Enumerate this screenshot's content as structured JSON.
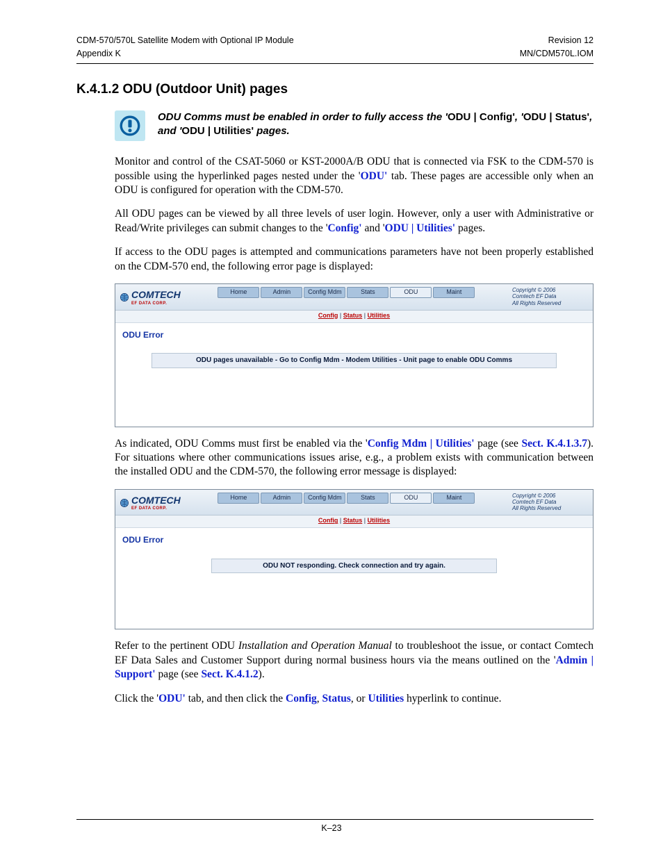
{
  "header": {
    "left1": "CDM-570/570L Satellite Modem with Optional IP Module",
    "left2": "Appendix K",
    "right1": "Revision 12",
    "right2": "MN/CDM570L.IOM"
  },
  "footer": {
    "page_num": "K–23"
  },
  "section": {
    "heading": "K.4.1.2   ODU (Outdoor Unit) pages"
  },
  "notice": {
    "lead": "ODU Comms must be enabled in order to fully access the '",
    "b1": "ODU | Config'",
    "mid1": ", '",
    "b2": "ODU | Status'",
    "mid2": ", and '",
    "b3": "ODU | Utilities'",
    "tail": " pages."
  },
  "paras": {
    "p1a": "Monitor and control of the CSAT-5060 or KST-2000A/B ODU that is connected via FSK to the CDM-570 is possible using the hyperlinked pages nested under the '",
    "p1link1": "ODU'",
    "p1b": " tab. These pages are accessible only when an ODU is configured for operation with the CDM-570.",
    "p2a": "All ODU pages can be viewed by all three levels of user login. However, only a user with Administrative or Read/Write privileges can submit changes to the '",
    "p2link1": "Config'",
    "p2b": " and '",
    "p2link2": "ODU | Utilities'",
    "p2c": " pages.",
    "p3": "If access to the ODU pages is attempted and communications parameters have not been properly established on the CDM-570 end, the following error page is displayed:",
    "p4a": "As indicated, ODU Comms must first be enabled via the '",
    "p4link1": "Config Mdm | Utilities'",
    "p4b": " page (see ",
    "p4link2": "Sect. K.4.1.3.7",
    "p4c": "). For situations where other communications issues arise, e.g., a problem exists with communication between the installed ODU and the CDM-570, the following error message is displayed:",
    "p5a": "Refer to the pertinent ODU ",
    "p5em": "Installation and Operation Manual",
    "p5b": " to troubleshoot the issue, or contact Comtech EF Data Sales and Customer Support during normal business hours via the means outlined on the '",
    "p5link1": "Admin | Support'",
    "p5c": " page (see ",
    "p5link2": "Sect. K.4.1.2",
    "p5d": ").",
    "p6a": "Click the '",
    "p6link1": "ODU'",
    "p6b": " tab, and then click the ",
    "p6link2": "Config",
    "p6c": ", ",
    "p6link3": "Status",
    "p6d": ", or ",
    "p6link4": "Utilities",
    "p6e": " hyperlink to continue."
  },
  "ui": {
    "logo_main": "COMTECH",
    "logo_sub": "EF DATA CORP.",
    "tabs": [
      "Home",
      "Admin",
      "Config Mdm",
      "Stats",
      "ODU",
      "Maint"
    ],
    "subtabs": {
      "a": "Config",
      "b": "Status",
      "c": "Utilities"
    },
    "copyright": {
      "l1": "Copyright © 2006",
      "l2": "Comtech EF Data",
      "l3": "All Rights Reserved"
    },
    "err_title": "ODU Error",
    "msg1": "ODU pages unavailable - Go to Config Mdm - Modem Utilities - Unit page to enable ODU Comms",
    "msg2": "ODU NOT responding. Check connection and try again."
  }
}
